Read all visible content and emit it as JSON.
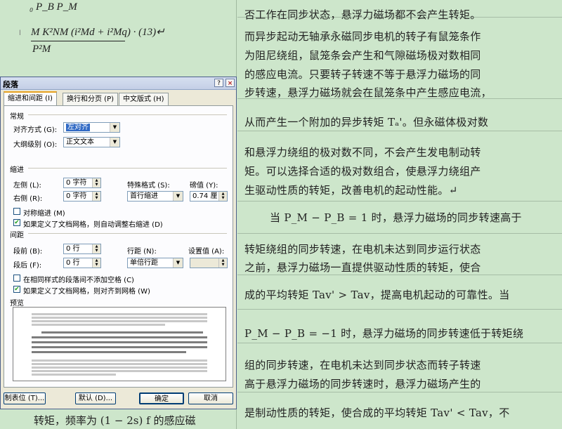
{
  "document": {
    "right_lines": [
      {
        "text": "否工作在同步状态，悬浮力磁场都不会产生转矩。"
      },
      {
        "text": "而异步起动无轴承永磁同步电机的转子有鼠笼条作"
      },
      {
        "text": "为阻尼绕组，鼠笼条会产生和气隙磁场极对数相同"
      },
      {
        "text": "的感应电流。只要转子转速不等于悬浮力磁场的同"
      },
      {
        "text": "步转速，悬浮力磁场就会在鼠笼条中产生感应电流，"
      },
      {
        "text": "从而产生一个附加的异步转矩 Tₐ'。但永磁体极对数"
      },
      {
        "text": "和悬浮力绕组的极对数不同，不会产生发电制动转"
      },
      {
        "text": "矩。可以选择合适的极对数组合，使悬浮力绕组产"
      },
      {
        "text": "生驱动性质的转矩，改善电机的起动性能。↵"
      },
      {
        "text": "当 P_M − P_B = 1 时，悬浮力磁场的同步转速高于"
      },
      {
        "text": "转矩绕组的同步转速，在电机未达到同步运行状态"
      },
      {
        "text": "之前，悬浮力磁场一直提供驱动性质的转矩，使合"
      },
      {
        "text": "成的平均转矩 Tav' > Tav，提高电机起动的可靠性。当"
      },
      {
        "text": "P_M − P_B = −1 时，悬浮力磁场的同步转速低于转矩绕"
      },
      {
        "text": "组的同步转速，在电机未达到同步状态而转子转速"
      },
      {
        "text": "高于悬浮力磁场的同步转速时，悬浮力磁场产生的"
      },
      {
        "text": "是制动性质的转矩，使合成的平均转矩 Tav' < Tav，不"
      }
    ],
    "formula_top": "₀ P_B P_M",
    "formula_num": "M K²NM (i²Md + i²Mq) · (13)↵",
    "formula_den": "P²M",
    "bottom_left": "转矩，频率为 (1 − 2s) f 的感应磁"
  },
  "dialog": {
    "title": "段落",
    "help_label": "?",
    "close_label": "×",
    "tabs": [
      {
        "label": "缩进和间距 (I)"
      },
      {
        "label": "换行和分页 (P)"
      },
      {
        "label": "中文版式 (H)"
      }
    ],
    "sections": {
      "general": "常规",
      "indent": "缩进",
      "spacing": "间距",
      "preview": "预览"
    },
    "general": {
      "alignment_label": "对齐方式 (G):",
      "alignment_value": "左对齐",
      "outline_label": "大纲级别 (O):",
      "outline_value": "正文文本"
    },
    "indent": {
      "left_label": "左侧 (L):",
      "left_value": "0 字符",
      "right_label": "右侧 (R):",
      "right_value": "0 字符",
      "special_label": "特殊格式 (S):",
      "special_value": "首行缩进",
      "by_label": "磅值 (Y):",
      "by_value": "0.74 厘",
      "mirror_label": "对称缩进 (M)",
      "auto_adjust_label": "如果定义了文档网格，则自动调整右缩进 (D)"
    },
    "spacing": {
      "before_label": "段前 (B):",
      "before_value": "0 行",
      "after_label": "段后 (F):",
      "after_value": "0 行",
      "line_label": "行距 (N):",
      "line_value": "单倍行距",
      "at_label": "设置值 (A):",
      "at_value": "",
      "no_space_label": "在相同样式的段落间不添加空格 (C)",
      "snap_grid_label": "如果定义了文档网格，则对齐到网格 (W)"
    },
    "checkboxes": {
      "mirror": false,
      "auto_adjust": true,
      "no_space": false,
      "snap_grid": true
    },
    "buttons": {
      "tabs": "制表位 (T)...",
      "default": "默认 (D)...",
      "ok": "确定",
      "cancel": "取消"
    },
    "colors": {
      "selection": "#316ac5",
      "tab_highlight": "#e6a11f",
      "doc_background": "#cde6cb"
    }
  }
}
